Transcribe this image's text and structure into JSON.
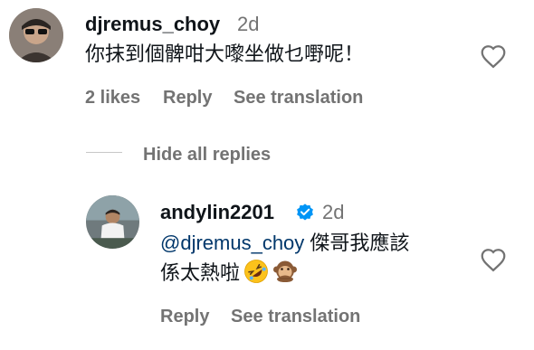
{
  "comment": {
    "username": "djremus_choy",
    "time": "2d",
    "text": "你抹到個髀咁大嚟坐做乜嘢呢！",
    "likes": "2 likes",
    "reply_label": "Reply",
    "translate_label": "See translation"
  },
  "replies_toggle": {
    "label": "Hide all replies"
  },
  "reply": {
    "username": "andylin2201",
    "time": "2d",
    "mention": "@djremus_choy",
    "text_part1": "傑哥我應該",
    "text_part2": "係太熱啦",
    "emojis": [
      "rolling-on-floor-laughing-emoji",
      "speak-no-evil-monkey-emoji"
    ],
    "reply_label": "Reply",
    "translate_label": "See translation"
  },
  "icons": {
    "heart": "heart-outline-icon",
    "verified": "verified-badge-icon"
  },
  "colors": {
    "verified_blue": "#0095f6",
    "mention": "#00376b",
    "secondary_text": "#737373"
  }
}
